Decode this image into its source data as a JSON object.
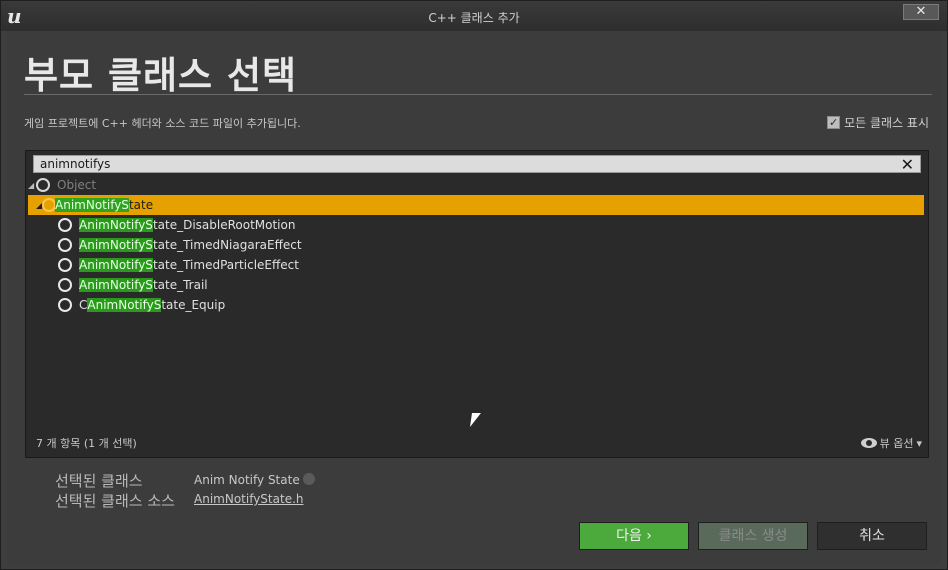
{
  "window": {
    "title": "C++ 클래스 추가",
    "close_label": "✕"
  },
  "header": {
    "title": "부모 클래스 선택",
    "subtitle": "게임 프로젝트에 C++ 헤더와 소스 코드 파일이 추가됩니다.",
    "show_all_label": "모든 클래스 표시",
    "show_all_checked": true
  },
  "search": {
    "value": "animnotifys",
    "clear_label": "✕"
  },
  "tree": {
    "root": {
      "label": "Object"
    },
    "selected": {
      "match": "AnimNotifyS",
      "rest": "tate"
    },
    "children": [
      {
        "prefix": "",
        "match": "AnimNotifyS",
        "rest": "tate_DisableRootMotion"
      },
      {
        "prefix": "",
        "match": "AnimNotifyS",
        "rest": "tate_TimedNiagaraEffect"
      },
      {
        "prefix": "",
        "match": "AnimNotifyS",
        "rest": "tate_TimedParticleEffect"
      },
      {
        "prefix": "",
        "match": "AnimNotifyS",
        "rest": "tate_Trail"
      },
      {
        "prefix": "C",
        "match": "AnimNotifyS",
        "rest": "tate_Equip"
      }
    ]
  },
  "footer": {
    "item_count": "7 개 항목 (1 개 선택)",
    "view_options": "뷰 옵션"
  },
  "info": {
    "selected_class_label": "선택된 클래스",
    "selected_class_value": "Anim Notify State",
    "selected_source_label": "선택된 클래스 소스",
    "selected_source_value": "AnimNotifyState.h"
  },
  "buttons": {
    "next": "다음 ›",
    "create": "클래스 생성",
    "cancel": "취소"
  },
  "colors": {
    "selection": "#e6a100",
    "match_highlight": "#2a9a1a",
    "next_button": "#4caa3c"
  }
}
